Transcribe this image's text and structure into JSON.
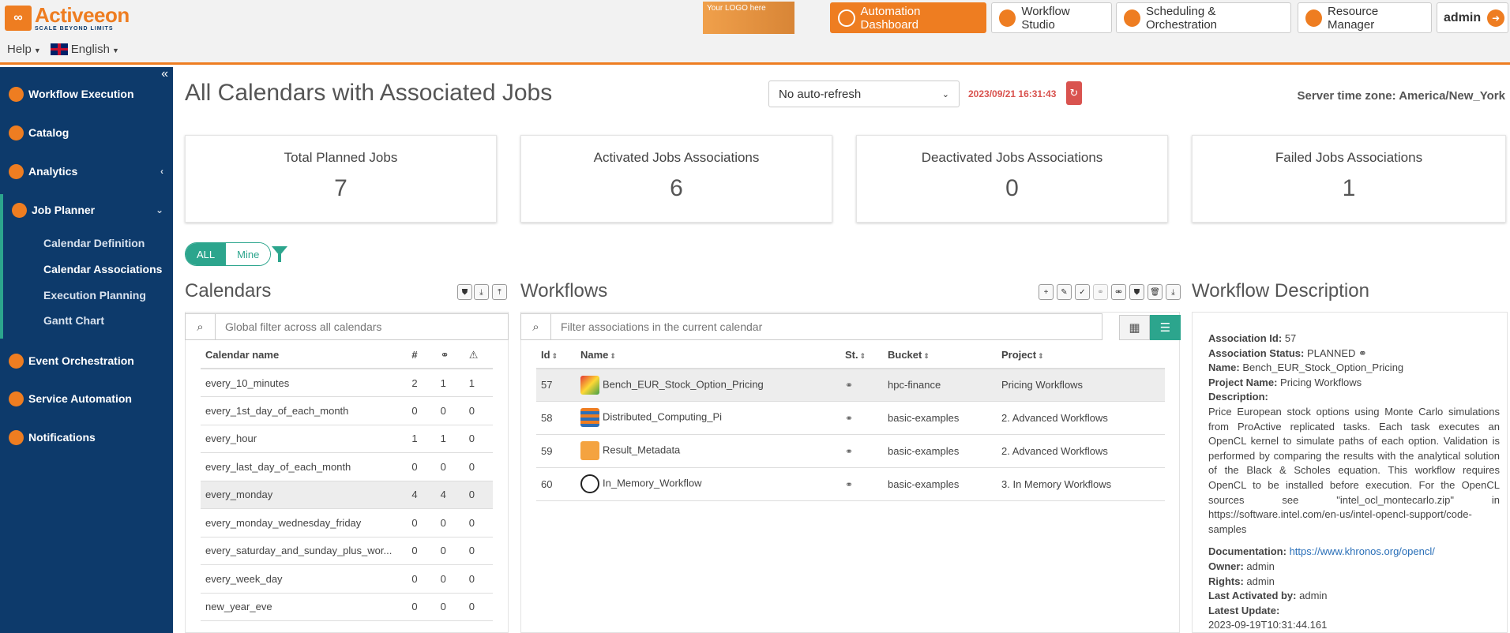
{
  "header": {
    "brand": "Activeeon",
    "tagline": "SCALE BEYOND LIMITS",
    "help": "Help",
    "language": "English",
    "your_logo": "Your LOGO here",
    "nav": [
      "Automation Dashboard",
      "Workflow Studio",
      "Scheduling & Orchestration",
      "Resource Manager"
    ],
    "user": "admin"
  },
  "sidebar": {
    "items": [
      {
        "label": "Workflow Execution"
      },
      {
        "label": "Catalog"
      },
      {
        "label": "Analytics"
      },
      {
        "label": "Job Planner"
      },
      {
        "label": "Event Orchestration"
      },
      {
        "label": "Service Automation"
      },
      {
        "label": "Notifications"
      }
    ],
    "job_planner_sub": [
      "Calendar Definition",
      "Calendar Associations",
      "Execution Planning",
      "Gantt Chart"
    ]
  },
  "page": {
    "title": "All Calendars with Associated Jobs",
    "refresh_option": "No auto-refresh",
    "datetime": "2023/09/21 16:31:43",
    "server_tz": "Server time zone: America/New_York"
  },
  "stats": [
    {
      "label": "Total Planned Jobs",
      "value": "7"
    },
    {
      "label": "Activated Jobs Associations",
      "value": "6"
    },
    {
      "label": "Deactivated Jobs Associations",
      "value": "0"
    },
    {
      "label": "Failed Jobs Associations",
      "value": "1"
    }
  ],
  "filter": {
    "all": "ALL",
    "mine": "Mine"
  },
  "calendars": {
    "title": "Calendars",
    "search_placeholder": "Global filter across all calendars",
    "columns": [
      "Calendar name",
      "#"
    ],
    "rows": [
      {
        "name": "every_10_minutes",
        "count": "2",
        "linked": "1",
        "warn": "1"
      },
      {
        "name": "every_1st_day_of_each_month",
        "count": "0",
        "linked": "0",
        "warn": "0"
      },
      {
        "name": "every_hour",
        "count": "1",
        "linked": "1",
        "warn": "0"
      },
      {
        "name": "every_last_day_of_each_month",
        "count": "0",
        "linked": "0",
        "warn": "0"
      },
      {
        "name": "every_monday",
        "count": "4",
        "linked": "4",
        "warn": "0"
      },
      {
        "name": "every_monday_wednesday_friday",
        "count": "0",
        "linked": "0",
        "warn": "0"
      },
      {
        "name": "every_saturday_and_sunday_plus_wor...",
        "count": "0",
        "linked": "0",
        "warn": "0"
      },
      {
        "name": "every_week_day",
        "count": "0",
        "linked": "0",
        "warn": "0"
      },
      {
        "name": "new_year_eve",
        "count": "0",
        "linked": "0",
        "warn": "0"
      }
    ]
  },
  "workflows": {
    "title": "Workflows",
    "search_placeholder": "Filter associations in the current calendar",
    "columns": [
      "Id",
      "Name",
      "St.",
      "Bucket",
      "Project"
    ],
    "rows": [
      {
        "id": "57",
        "name": "Bench_EUR_Stock_Option_Pricing",
        "bucket": "hpc-finance",
        "project": "Pricing Workflows"
      },
      {
        "id": "58",
        "name": "Distributed_Computing_Pi",
        "bucket": "basic-examples",
        "project": "2. Advanced Workflows"
      },
      {
        "id": "59",
        "name": "Result_Metadata",
        "bucket": "basic-examples",
        "project": "2. Advanced Workflows"
      },
      {
        "id": "60",
        "name": "In_Memory_Workflow",
        "bucket": "basic-examples",
        "project": "3. In Memory Workflows"
      }
    ]
  },
  "description": {
    "title": "Workflow Description",
    "assoc_id_label": "Association Id:",
    "assoc_id": "57",
    "status_label": "Association Status:",
    "status": "PLANNED",
    "name_label": "Name:",
    "name": "Bench_EUR_Stock_Option_Pricing",
    "project_label": "Project Name:",
    "project": "Pricing Workflows",
    "desc_label": "Description:",
    "desc": "Price European stock options using Monte Carlo simulations from ProActive replicated tasks. Each task executes an OpenCL kernel to simulate paths of each option. Validation is performed by comparing the results with the analytical solution of the Black & Scholes equation. This workflow requires OpenCL to be installed before execution. For the OpenCL sources see \"intel_ocl_montecarlo.zip\" in https://software.intel.com/en-us/intel-opencl-support/code-samples",
    "doc_label": "Documentation:",
    "doc": "https://www.khronos.org/opencl/",
    "owner_label": "Owner:",
    "owner": "admin",
    "rights_label": "Rights:",
    "rights": "admin",
    "activated_label": "Last Activated by:",
    "activated": "admin",
    "update_label": "Latest Update:",
    "update": "2023-09-19T10:31:44.161"
  }
}
